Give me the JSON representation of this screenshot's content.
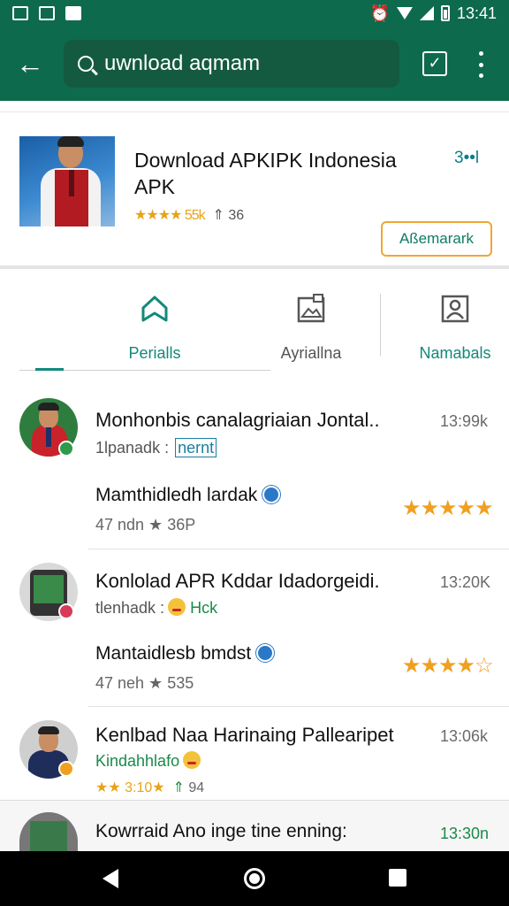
{
  "status_bar": {
    "time": "13:41"
  },
  "search": {
    "query": "uwnload aqmam"
  },
  "app": {
    "title": "Download APKIPK Indonesia APK",
    "rating_text": "★★★★ 55k",
    "downloads_text": "36",
    "size_text": "3••l",
    "install_label": "Aßemarark"
  },
  "tabs": [
    {
      "label": "Perialls",
      "icon": "bookmark-icon",
      "active": true
    },
    {
      "label": "Ayriallna",
      "icon": "document-image-icon",
      "active": false
    },
    {
      "label": "Namabals",
      "icon": "person-card-icon",
      "active": false
    }
  ],
  "reviews": [
    {
      "avatar_icon": "person-avatar",
      "title": "Monhonbis canalagriaian Jontal..",
      "time": "13:99k",
      "subtitle_prefix": "1lpanadk :",
      "subtitle_tag": "nernt",
      "line2": "Mamthidledh lardak",
      "meta": "47  ndn  ★ 36P",
      "stars": "★★★★★"
    },
    {
      "avatar_icon": "phone-avatar",
      "title": "Konlolad APR Kddar Idadorgeidi.",
      "time": "13:20K",
      "subtitle_prefix": "tlenhadk :",
      "subtitle_tag": "Hck",
      "line2": "Mantaidlesb bmdst",
      "meta": "47  neh  ★ 535",
      "stars": "★★★★☆"
    },
    {
      "avatar_icon": "person-avatar",
      "title": "Kenlbad Naa Harinaing Pallearipet",
      "time": "13:06k",
      "subtitle_prefix": "Kindahhlafo",
      "meta": "★★ 3:10★",
      "downloads": "94"
    }
  ],
  "last_item": {
    "title": "Kowrraid Ano inge tine enning:",
    "time": "13:30n"
  }
}
